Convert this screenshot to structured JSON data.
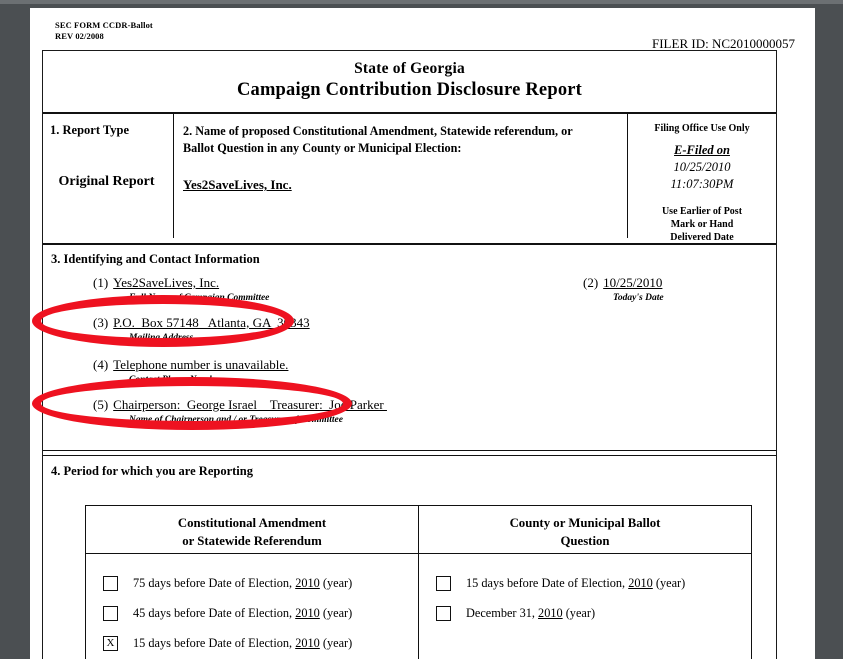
{
  "document": {
    "form_code": "SEC FORM CCDR-Ballot",
    "revision": "REV 02/2008",
    "filer_id": "FILER ID: NC2010000057",
    "title_line1": "State of Georgia",
    "title_line2": "Campaign Contribution Disclosure Report"
  },
  "section1": {
    "heading": "1.  Report Type",
    "value": "Original Report"
  },
  "section2": {
    "heading_line1": "2.  Name of proposed Constitutional Amendment, Statewide referendum, or",
    "heading_line2": "Ballot Question in any County or Municipal Election:",
    "value": "Yes2SaveLives, Inc."
  },
  "filing_office": {
    "title": "Filing Office Use Only",
    "efiled_label": "E-Filed on",
    "date": "10/25/2010",
    "time": "11:07:30PM",
    "note_line1": "Use Earlier of Post",
    "note_line2": "Mark or Hand",
    "note_line3": "Delivered Date"
  },
  "section3": {
    "heading": "3.  Identifying and Contact Information",
    "fields": [
      {
        "number": "(1)",
        "value": "Yes2SaveLives, Inc.",
        "caption": "Full Name of  Campaign Committee"
      },
      {
        "number": "(2)",
        "value": "10/25/2010",
        "caption": "Today's Date"
      },
      {
        "number": "(3)",
        "value": "P.O.  Box 57148   Atlanta, GA  30343",
        "caption": "Mailing Address"
      },
      {
        "number": "(4)",
        "value": "Telephone number is unavailable.",
        "caption": "Contact Phone Number"
      },
      {
        "number": "(5)",
        "value": "Chairperson:  George Israel    Treasurer:  Joe Parker ",
        "caption": "Name of Chairperson and / or Treasurer of Committee"
      }
    ]
  },
  "section4": {
    "heading": "4.  Period for which you are Reporting",
    "columns": [
      {
        "head_line1": "Constitutional Amendment",
        "head_line2": "or Statewide Referendum",
        "options": [
          {
            "checked": false,
            "mark": "",
            "pre": "75 days before Date of Election, ",
            "year": "2010",
            "post": " (year)"
          },
          {
            "checked": false,
            "mark": "",
            "pre": "45 days before Date of Election, ",
            "year": "2010",
            "post": " (year)"
          },
          {
            "checked": true,
            "mark": "X",
            "pre": "15 days before Date of Election, ",
            "year": "2010",
            "post": " (year)"
          }
        ]
      },
      {
        "head_line1": "County or Municipal Ballot",
        "head_line2": "Question",
        "options": [
          {
            "checked": false,
            "mark": "",
            "pre": "15 days before Date of  Election, ",
            "year": "2010",
            "post": " (year)"
          },
          {
            "checked": false,
            "mark": "",
            "pre": "December 31, ",
            "year": "2010",
            "post": " (year)"
          }
        ]
      }
    ]
  },
  "annotations": {
    "color": "#ee1220",
    "shapes": [
      {
        "name": "mailing-address-highlight",
        "target": "section3.fields.2"
      },
      {
        "name": "officers-highlight",
        "target": "section3.fields.4"
      }
    ]
  }
}
